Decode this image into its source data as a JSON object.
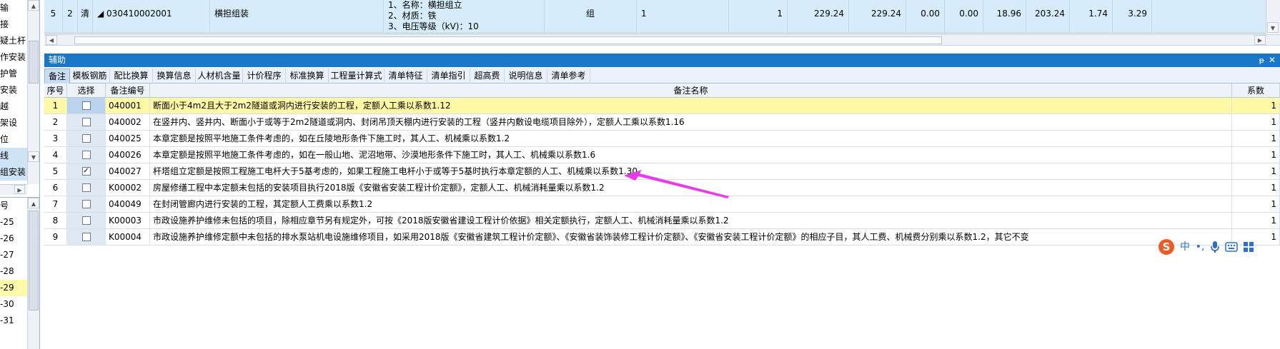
{
  "left_tree": {
    "items": [
      {
        "label": "输",
        "selected": false
      },
      {
        "label": "接",
        "selected": false
      },
      {
        "label": "疑土杆",
        "selected": false
      },
      {
        "label": "作安装",
        "selected": false
      },
      {
        "label": "护管",
        "selected": false
      },
      {
        "label": "安装",
        "selected": false
      },
      {
        "label": "越",
        "selected": false
      },
      {
        "label": "架设",
        "selected": false
      },
      {
        "label": "位",
        "selected": false
      },
      {
        "label": "线",
        "selected": true
      },
      {
        "label": "组安装",
        "selected": true
      }
    ],
    "bottom_header": "号",
    "bottom_items": [
      {
        "label": "-25",
        "highlight": false
      },
      {
        "label": "-26",
        "highlight": false
      },
      {
        "label": "-27",
        "highlight": false
      },
      {
        "label": "-28",
        "highlight": false
      },
      {
        "label": "-29",
        "highlight": true
      },
      {
        "label": "-30",
        "highlight": false
      },
      {
        "label": "-31",
        "highlight": false
      }
    ]
  },
  "top_row": {
    "seq": "5",
    "num": "2",
    "type": "清",
    "code": "◢ 030410002001",
    "name": "横担组装",
    "features": [
      "1、名称：横担组立",
      "2、材质：铁",
      "3、电压等级（kV)：10"
    ],
    "unit": "组",
    "qty_expr": "1",
    "qty": "1",
    "v1": "229.24",
    "v2": "229.24",
    "v3": "0.00",
    "v4": "0.00",
    "v5": "18.96",
    "v6": "203.24",
    "v7": "1.74",
    "v8": "3.29"
  },
  "aux_panel": {
    "title": "辅助",
    "pin_icon": "ᵽ",
    "close_icon": "✕",
    "tabs": [
      "备注",
      "模板钢筋",
      "配比换算",
      "换算信息",
      "人材机含量",
      "计价程序",
      "标准换算",
      "工程量计算式",
      "清单特征",
      "清单指引",
      "超高费",
      "说明信息",
      "清单参考"
    ],
    "active_tab": 0
  },
  "grid": {
    "headers": {
      "seq": "序号",
      "select": "选择",
      "code": "备注编号",
      "name": "备注名称",
      "coef": "系数"
    },
    "rows": [
      {
        "seq": "1",
        "checked": false,
        "code": "040001",
        "name": "断面小于4m2且大于2m2隧道或洞内进行安装的工程，定额人工乘以系数1.12",
        "coef": "1",
        "highlight": true
      },
      {
        "seq": "2",
        "checked": false,
        "code": "040002",
        "name": "在竖井内、竖井内、断面小于或等于2m2隧道或洞内、封闭吊顶天棚内进行安装的工程（竖井内敷设电缆项目除外），定额人工乘以系数1.16",
        "coef": "1",
        "highlight": false
      },
      {
        "seq": "3",
        "checked": false,
        "code": "040025",
        "name": "本章定额是按照平地施工条件考虑的，如在丘陵地形条件下施工时，其人工、机械乘以系数1.2",
        "coef": "1",
        "highlight": false
      },
      {
        "seq": "4",
        "checked": false,
        "code": "040026",
        "name": "本章定额是按照平地施工条件考虑的，如在一般山地、泥沼地带、沙漠地形条件下施工时，其人工、机械乘以系数1.6",
        "coef": "1",
        "highlight": false
      },
      {
        "seq": "5",
        "checked": true,
        "code": "040027",
        "name": "杆塔组立定额是按照工程施工电杆大于5基考虑的，如果工程施工电杆小于或等于5基时执行本章定额的人工、机械乘以系数1.30",
        "coef": "1",
        "highlight": false
      },
      {
        "seq": "6",
        "checked": false,
        "code": "K00002",
        "name": "房屋修缮工程中本定额未包括的安装项目执行2018版《安徽省安装工程计价定额》，定额人工、机械消耗量乘以系数1.2",
        "coef": "1",
        "highlight": false
      },
      {
        "seq": "7",
        "checked": false,
        "code": "040049",
        "name": "在封闭管廊内进行安装的工程，其定额人工费乘以系数1.2",
        "coef": "1",
        "highlight": false
      },
      {
        "seq": "8",
        "checked": false,
        "code": "K00003",
        "name": "市政设施养护维修未包括的项目，除相应章节另有规定外，可按《2018版安徽省建设工程计价依据》相关定额执行，定额人工、机械消耗量乘以系数1.2",
        "coef": "1",
        "highlight": false
      },
      {
        "seq": "9",
        "checked": false,
        "code": "K00004",
        "name": "市政设施养护维修定额中未包括的排水泵站机电设施维修项目，如采用2018版《安徽省建筑工程计价定额》、《安徽省装饰装修工程计价定额》、《安徽省安装工程计价定额》的相应子目，其人工费、机械费分别乘以系数1.2，其它不变",
        "coef": "1",
        "highlight": false
      }
    ]
  },
  "ime_bar": {
    "logo": "S",
    "mode": "中",
    "punct": "•,",
    "mic_icon": "mic-icon",
    "keyboard_icon": "keyboard-icon",
    "grid_icon": "grid-icon"
  },
  "colors": {
    "title_bar": "#1976c8",
    "highlight_row": "#fff9a6",
    "arrow": "#e83ae8",
    "top_row_bg": "#d6ecfb"
  }
}
